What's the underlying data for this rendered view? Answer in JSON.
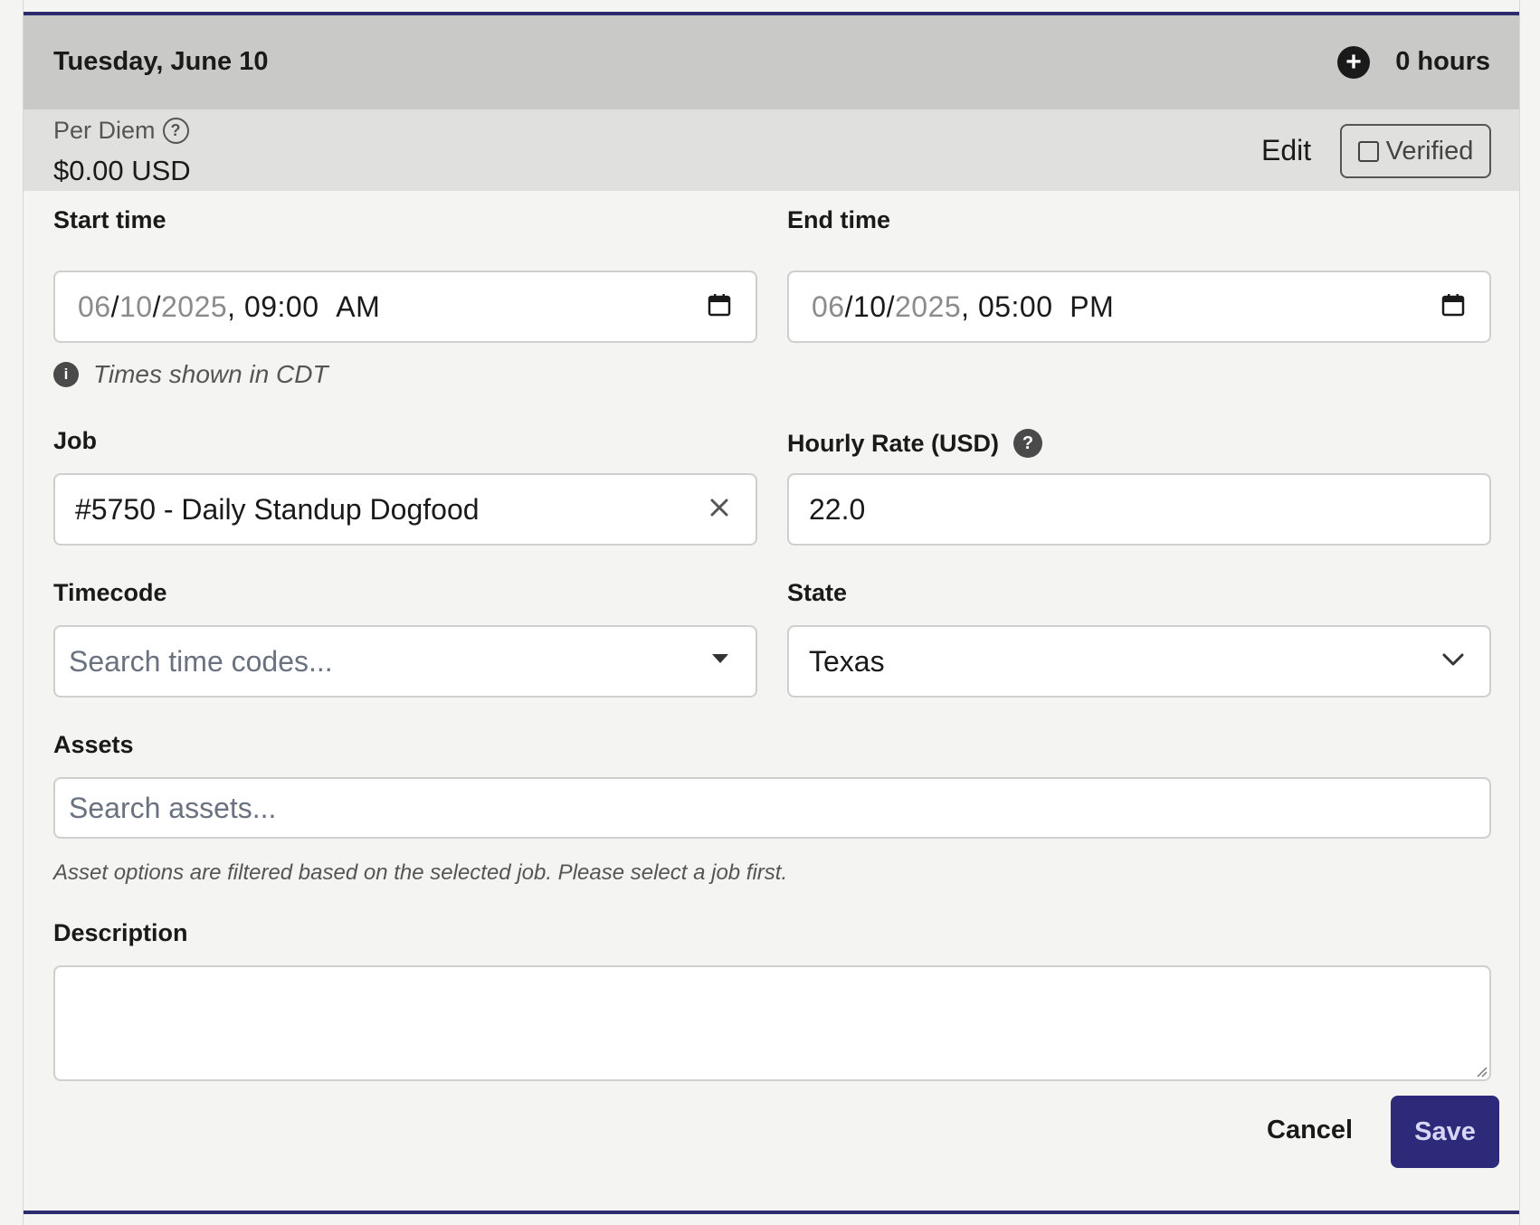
{
  "day": {
    "title": "Tuesday, June 10",
    "hours": "0 hours"
  },
  "per_diem": {
    "label": "Per Diem",
    "amount": "$0.00 USD",
    "edit_label": "Edit",
    "verified_label": "Verified",
    "verified_checked": false
  },
  "start_time": {
    "label": "Start time",
    "month": "06",
    "day": "10",
    "year": "2025",
    "time": "09:00",
    "ampm": "AM"
  },
  "end_time": {
    "label": "End time",
    "month": "06",
    "day": "10",
    "year": "2025",
    "time": "05:00",
    "ampm": "PM"
  },
  "timezone_note": "Times shown in CDT",
  "job": {
    "label": "Job",
    "value": "#5750 - Daily Standup Dogfood"
  },
  "hourly_rate": {
    "label": "Hourly Rate (USD)",
    "value": "22.0"
  },
  "timecode": {
    "label": "Timecode",
    "placeholder": "Search time codes..."
  },
  "state": {
    "label": "State",
    "value": "Texas"
  },
  "assets": {
    "label": "Assets",
    "placeholder": "Search assets...",
    "hint": "Asset options are filtered based on the selected job. Please select a job first."
  },
  "description": {
    "label": "Description",
    "value": ""
  },
  "actions": {
    "cancel_label": "Cancel",
    "save_label": "Save"
  },
  "colors": {
    "accent": "#2d2a7a",
    "header_bg": "#c9c9c8",
    "perdiem_bg": "#e0e0df",
    "page_bg": "#f4f4f2"
  },
  "icons": [
    "plus-circle-icon",
    "help-outline-icon",
    "calendar-icon",
    "info-icon",
    "help-solid-icon",
    "close-icon",
    "caret-down-icon",
    "chevron-down-icon",
    "resize-grip-icon"
  ]
}
